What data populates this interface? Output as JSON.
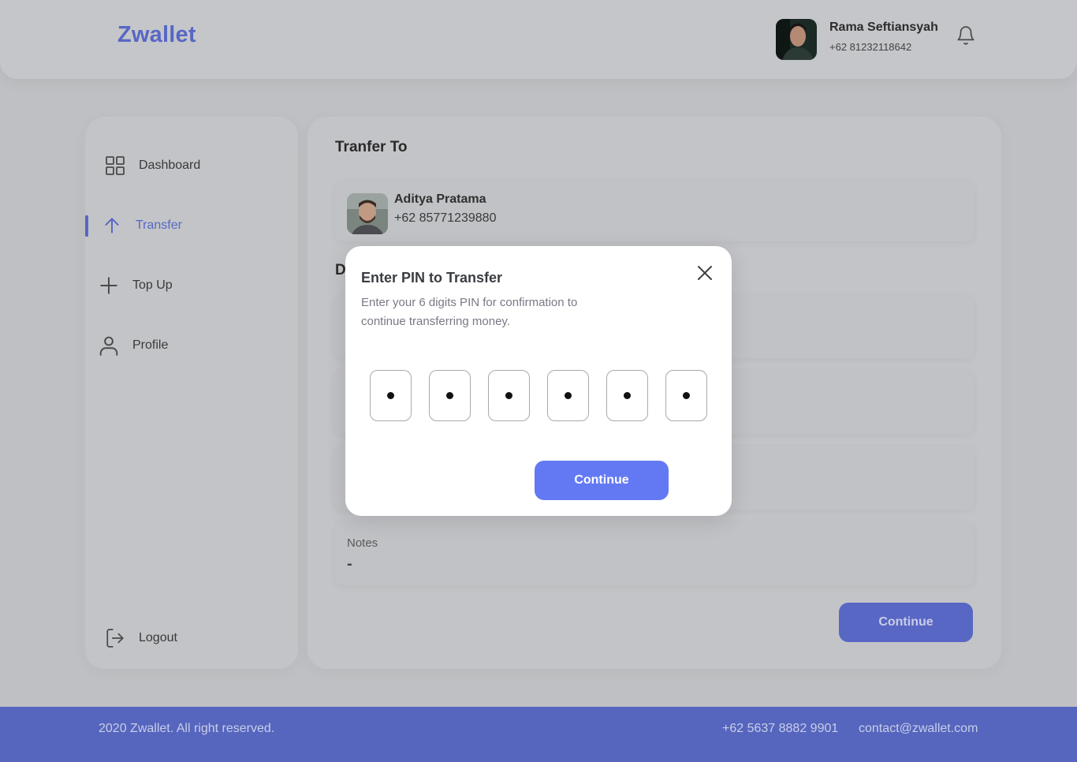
{
  "header": {
    "brand": "Zwallet",
    "user": {
      "name": "Rama Seftiansyah",
      "phone": "+62 81232118642",
      "avatar_icon": "avatar"
    },
    "notification_icon": "bell-icon"
  },
  "sidebar": {
    "items": [
      {
        "label": "Dashboard",
        "icon": "grid-icon",
        "active": false
      },
      {
        "label": "Transfer",
        "icon": "arrow-up-icon",
        "active": true
      },
      {
        "label": "Top Up",
        "icon": "plus-icon",
        "active": false
      },
      {
        "label": "Profile",
        "icon": "user-icon",
        "active": false
      }
    ],
    "logout": {
      "label": "Logout",
      "icon": "logout-icon"
    }
  },
  "main": {
    "title": "Tranfer To",
    "recipient": {
      "name": "Aditya Pratama",
      "phone": "+62 85771239880"
    },
    "details_title_visible": "D",
    "notes": {
      "label": "Notes",
      "value": "-"
    },
    "continue_label": "Continue"
  },
  "modal": {
    "title": "Enter PIN to Transfer",
    "description": "Enter your 6 digits PIN for confirmation to continue transferring money.",
    "pin_length": 6,
    "pin_filled": 6,
    "continue_label": "Continue",
    "close_icon": "close-icon"
  },
  "footer": {
    "copyright": "2020 Zwallet. All right reserved.",
    "phone": "+62 5637 8882 9901",
    "email": "contact@zwallet.com"
  },
  "colors": {
    "brand": "#5867c4",
    "accent": "#6379f4",
    "footer": "#5666be"
  }
}
